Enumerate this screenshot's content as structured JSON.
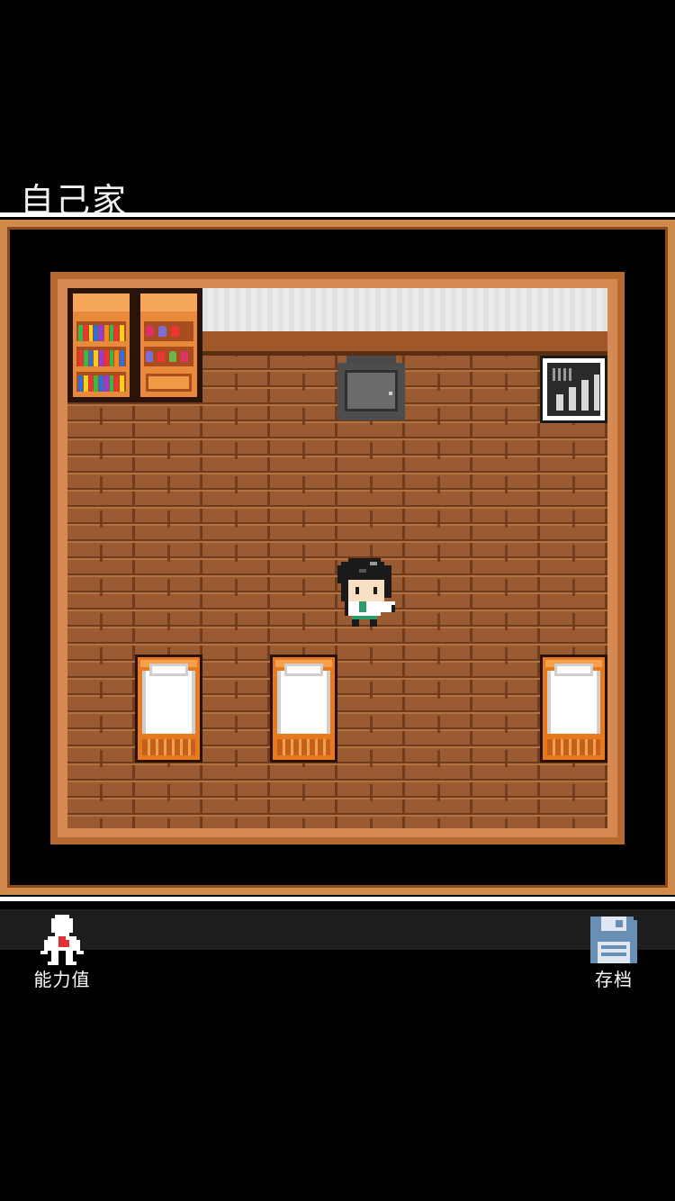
{
  "location": {
    "title": "自己家"
  },
  "menu": {
    "stats_label": "能力值",
    "save_label": "存档"
  },
  "colors": {
    "background": "#000000",
    "frame": "#d08a4b",
    "floor": "#9a5a32",
    "bed_frame": "#e77a1f",
    "save_icon": "#6a8fb5"
  },
  "icons": {
    "stats": "character-stats-icon",
    "save": "floppy-disk-icon"
  }
}
